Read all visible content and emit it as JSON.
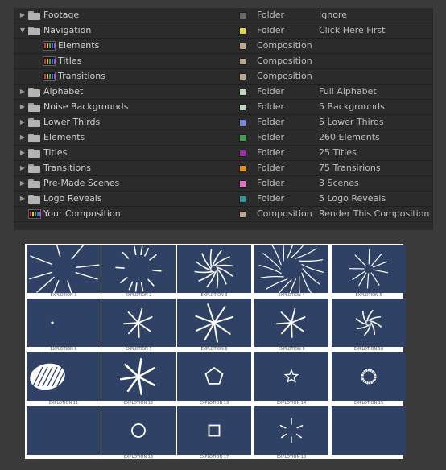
{
  "project_panel": {
    "rows": [
      {
        "name": "Footage",
        "type": "Folder",
        "comment": "Ignore",
        "label_color": "#6a6a6a",
        "kind": "folder",
        "expanded": false,
        "indent": 0
      },
      {
        "name": "Navigation",
        "type": "Folder",
        "comment": "Click Here First",
        "label_color": "#e5d43a",
        "kind": "folder",
        "expanded": true,
        "indent": 0
      },
      {
        "name": "Elements",
        "type": "Composition",
        "comment": "",
        "label_color": "#bda88a",
        "kind": "comp",
        "indent": 1
      },
      {
        "name": "Titles",
        "type": "Composition",
        "comment": "",
        "label_color": "#bda88a",
        "kind": "comp",
        "indent": 1
      },
      {
        "name": "Transitions",
        "type": "Composition",
        "comment": "",
        "label_color": "#bda88a",
        "kind": "comp",
        "indent": 1
      },
      {
        "name": "Alphabet",
        "type": "Folder",
        "comment": "Full Alphabet",
        "label_color": "#b9d7bd",
        "kind": "folder",
        "expanded": false,
        "indent": 0
      },
      {
        "name": "Noise Backgrounds",
        "type": "Folder",
        "comment": "5 Backgrounds",
        "label_color": "#b9d7bd",
        "kind": "folder",
        "expanded": false,
        "indent": 0
      },
      {
        "name": "Lower Thirds",
        "type": "Folder",
        "comment": "5 Lower Thirds",
        "label_color": "#7b87e6",
        "kind": "folder",
        "expanded": false,
        "indent": 0
      },
      {
        "name": "Elements",
        "type": "Folder",
        "comment": "260 Elements",
        "label_color": "#43a34a",
        "kind": "folder",
        "expanded": false,
        "indent": 0
      },
      {
        "name": "Titles",
        "type": "Folder",
        "comment": "25 Titles",
        "label_color": "#9a2fa8",
        "kind": "folder",
        "expanded": false,
        "indent": 0
      },
      {
        "name": "Transitions",
        "type": "Folder",
        "comment": "75 Transirions",
        "label_color": "#e4930f",
        "kind": "folder",
        "expanded": false,
        "indent": 0
      },
      {
        "name": "Pre-Made Scenes",
        "type": "Folder",
        "comment": "3 Scenes",
        "label_color": "#e86fc6",
        "kind": "folder",
        "expanded": false,
        "indent": 0
      },
      {
        "name": "Logo Reveals",
        "type": "Folder",
        "comment": "5 Logo Reveals",
        "label_color": "#2f9aa0",
        "kind": "folder",
        "expanded": false,
        "indent": 0
      },
      {
        "name": "Your Composition",
        "type": "Composition",
        "comment": "Render This Composition",
        "label_color": "#bda88a",
        "kind": "comp",
        "indent": 0
      }
    ]
  },
  "thumbnails": {
    "background_color": "#2f4164",
    "items": [
      {
        "caption": "EXPLOTION 1",
        "icon": "burst-lines-icon"
      },
      {
        "caption": "EXPLOTION 2",
        "icon": "scatter-dashes-icon"
      },
      {
        "caption": "EXPLOTION 3",
        "icon": "spiral-burst-icon"
      },
      {
        "caption": "EXPLOTION 4",
        "icon": "curved-burst-icon"
      },
      {
        "caption": "EXPLOTION 5",
        "icon": "thin-burst-icon"
      },
      {
        "caption": "EXPLOTION 6",
        "icon": "dot-icon"
      },
      {
        "caption": "EXPLOTION 7",
        "icon": "star-burst-icon"
      },
      {
        "caption": "EXPLOTION 8",
        "icon": "star-burst-large-icon"
      },
      {
        "caption": "EXPLOTION 9",
        "icon": "star-burst-icon"
      },
      {
        "caption": "EXPLOTION 10",
        "icon": "swirl-icon"
      },
      {
        "caption": "EXPLOTION 11",
        "icon": "scribble-ball-icon"
      },
      {
        "caption": "EXPLOTION 12",
        "icon": "asterisk-icon"
      },
      {
        "caption": "EXPLOTION 13",
        "icon": "pentagon-icon"
      },
      {
        "caption": "EXPLOTION 14",
        "icon": "star-outline-icon"
      },
      {
        "caption": "EXPLOTION 15",
        "icon": "ring-icon"
      },
      {
        "caption": "",
        "icon": "empty"
      },
      {
        "caption": "EXPLOTION 16",
        "icon": "circle-outline-icon"
      },
      {
        "caption": "EXPLOTION 17",
        "icon": "square-outline-icon"
      },
      {
        "caption": "EXPLOTION 18",
        "icon": "dash-burst-icon"
      },
      {
        "caption": "",
        "icon": "empty"
      }
    ]
  }
}
